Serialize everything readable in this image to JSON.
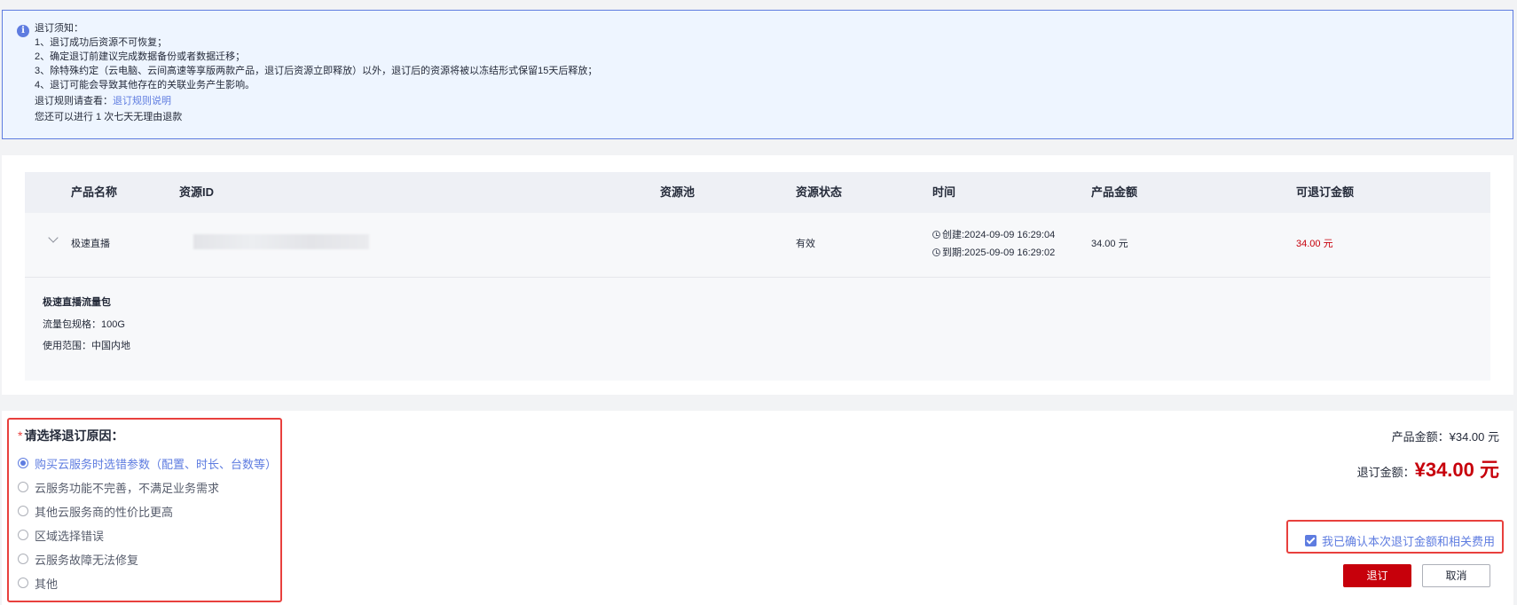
{
  "notice": {
    "title": "退订须知：",
    "items": [
      "1、退订成功后资源不可恢复；",
      "2、确定退订前建议完成数据备份或者数据迁移；",
      "3、除特殊约定（云电脑、云间高速等享版两款产品，退订后资源立即释放）以外，退订后的资源将被以冻结形式保留15天后释放；",
      "4、退订可能会导致其他存在的关联业务产生影响。"
    ],
    "rule_prefix": "退订规则请查看：",
    "rule_link": "退订规则说明",
    "free_refund": "您还可以进行 1 次七天无理由退款"
  },
  "table": {
    "headers": [
      "产品名称",
      "资源ID",
      "资源池",
      "资源状态",
      "时间",
      "产品金额",
      "可退订金额"
    ],
    "row": {
      "product": "极速直播",
      "resource_id": "",
      "pool": "",
      "status": "有效",
      "created": "创建:2024-09-09 16:29:04",
      "expires": "到期:2025-09-09 16:29:02",
      "amount": "34.00 元",
      "refundable": "34.00 元"
    },
    "detail": {
      "title": "极速直播流量包",
      "spec": "流量包规格：100G",
      "scope": "使用范围：中国内地"
    }
  },
  "reason": {
    "required_mark": "*",
    "title": "请选择退订原因：",
    "options": [
      "购买云服务时选错参数（配置、时长、台数等）",
      "云服务功能不完善，不满足业务需求",
      "其他云服务商的性价比更高",
      "区域选择错误",
      "云服务故障无法修复",
      "其他"
    ],
    "selected_index": 0
  },
  "summary": {
    "product_amount_label": "产品金额：",
    "product_amount": "¥34.00 元",
    "refund_label": "退订金额：",
    "refund_amount": "¥34.00 元",
    "confirm_label": "我已确认本次退订金额和相关费用",
    "confirm_checked": true
  },
  "buttons": {
    "submit": "退订",
    "cancel": "取消"
  },
  "colors": {
    "accent": "#5e7ce0",
    "danger": "#c7000b",
    "highlight_border": "#e8403d"
  }
}
